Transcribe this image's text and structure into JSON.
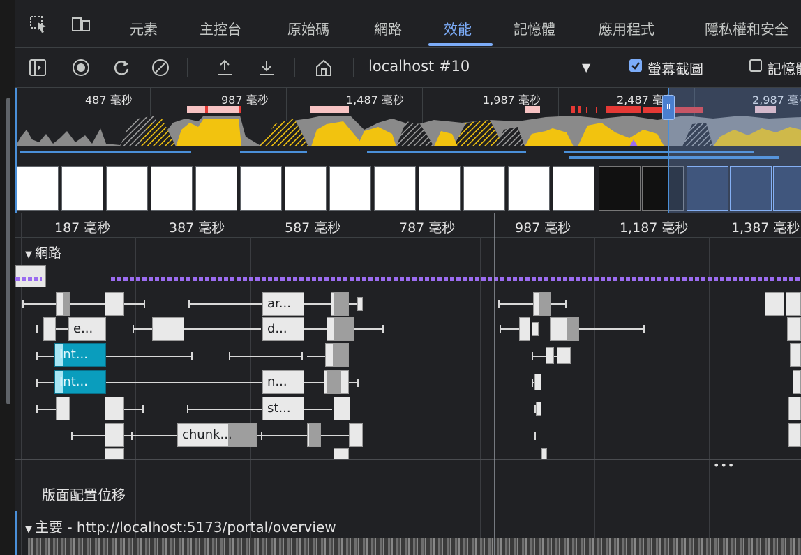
{
  "tabs": [
    {
      "label": "元素",
      "active": false
    },
    {
      "label": "主控台",
      "active": false
    },
    {
      "label": "原始碼",
      "active": false
    },
    {
      "label": "網路",
      "active": false
    },
    {
      "label": "效能",
      "active": true
    },
    {
      "label": "記憶體",
      "active": false
    },
    {
      "label": "應用程式",
      "active": false
    },
    {
      "label": "隱私權和安全",
      "active": false
    }
  ],
  "toolbar": {
    "target": "localhost #10",
    "screenshots_label": "螢幕截圖",
    "screenshots_checked": true,
    "memory_label": "記憶體",
    "memory_checked": false
  },
  "overview": {
    "ticks": [
      "487 毫秒",
      "987 毫秒",
      "1,487 毫秒",
      "1,987 毫秒",
      "2,487 毫秒",
      "2,987 毫秒"
    ]
  },
  "ruler": {
    "ticks": [
      "187 毫秒",
      "387 毫秒",
      "587 毫秒",
      "787 毫秒",
      "987 毫秒",
      "1,187 毫秒",
      "1,387 毫秒"
    ]
  },
  "network": {
    "title": "網路",
    "labels": {
      "ar": "ar...",
      "e": "e...",
      "d": "d...",
      "int1": "Int...",
      "int2": "Int...",
      "n": "n...",
      "st": "st...",
      "chunk": "chunk..."
    }
  },
  "layout_shift": "版面配置位移",
  "main_thread": "主要 - http://localhost:5173/portal/overview",
  "colors": {
    "accent": "#7cacf8",
    "scripting": "#f2c30f",
    "network_cyan": "#0a9dbd",
    "purple": "#9b6cf0"
  }
}
